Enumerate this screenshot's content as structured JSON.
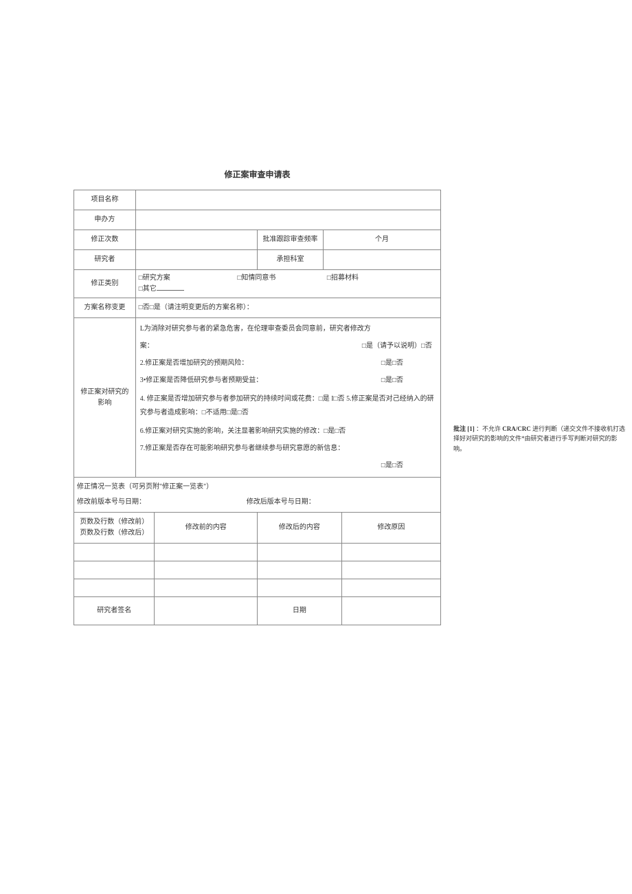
{
  "title": "修正案审查申请表",
  "rows": {
    "project_name_lbl": "项目名称",
    "sponsor_lbl": "申办方",
    "amend_count_lbl": "修正次数",
    "tracking_freq_lbl": "批准跟踪审查频率",
    "tracking_freq_val": "个月",
    "researcher_lbl": "研究者",
    "dept_lbl": "承担科室",
    "category_lbl": "修正类别",
    "cat1": "□研究方案",
    "cat2": "□知情同意书",
    "cat3": "□招募材料",
    "cat4_prefix": "□其它",
    "name_change_lbl": "方案名称变更",
    "name_change_val": "□否□是（请注明变更后的方案名称）：",
    "impact_lbl1": "修正案对研究的",
    "impact_lbl2": "影响",
    "impact_q1a": "L为消除对研究参与者的紧急危害，在伦理审查委员会同意前，研究者修改方",
    "impact_q1b": "案：",
    "impact_q1_opts": "□是（请予以说明）□否",
    "impact_q2": "2.修正案是否增加研究的预期风险：",
    "impact_q2_opts": "□是□否",
    "impact_q3": "3•修正案是否降低研究参与者预期受益：",
    "impact_q3_opts": "□是□否",
    "impact_q45": "4. 修正案是否增加研究参与者参加研究的持续时间或花费：□是 I□否 5.修正案是否对己经纳入的研究参与者造成影响：□不适用□是□否",
    "impact_q6": "6.修正案对研究实施的影响，关注显著影响研究实施的修改：□是□否",
    "impact_q7": "7.修正案是否存在可能影响研究参与者继续参与研究意愿的新信息：",
    "impact_q7_opts": "□是□否",
    "list_title": "修正情况一览表（可另页附\"修正案一览表\"）",
    "before_ver_lbl": "修改前版本号与日期：",
    "after_ver_lbl": "修改后版本号与日期：",
    "hdr_pages_before": "页数及行数（修改前）",
    "hdr_pages_after": "页数及行数（修改后）",
    "hdr_content_before": "修改前的内容",
    "hdr_content_after": "修改后的内容",
    "hdr_reason": "修改原因",
    "sign_lbl": "研究者签名",
    "date_lbl": "日期"
  },
  "note": {
    "prefix": "批注 [1] ",
    "bold1": "：",
    "text1": "不允许 ",
    "bold2": "CRA/CRC",
    "text2": " 进行判断（递交文件不接收机打选择好对研究的影响的文件*由研究者进行手写判断对研究的影响。"
  }
}
